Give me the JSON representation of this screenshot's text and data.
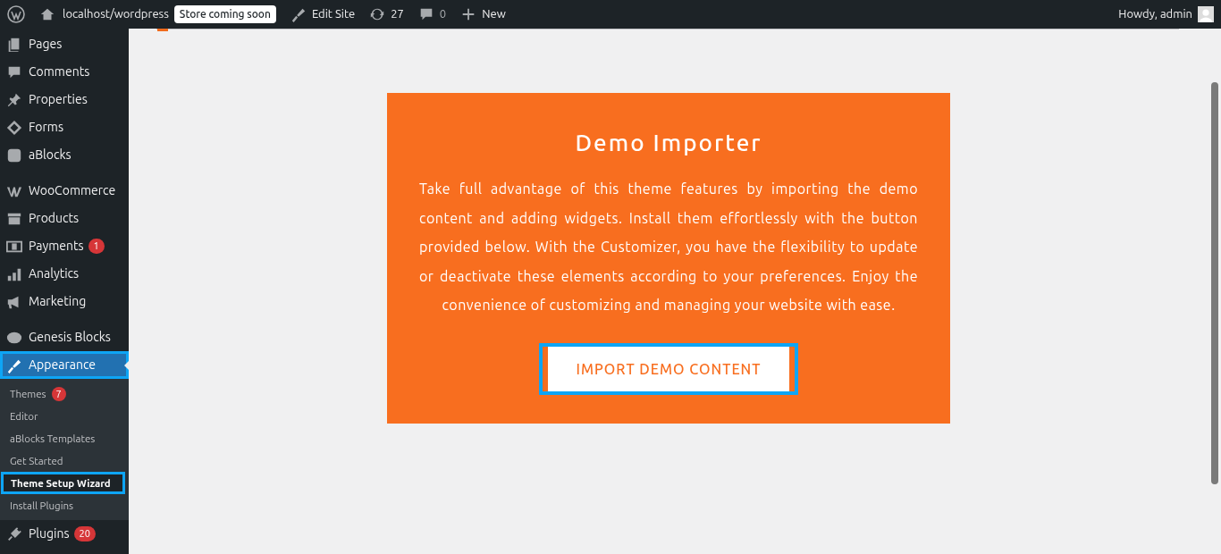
{
  "admin_bar": {
    "site": "localhost/wordpress",
    "store_badge": "Store coming soon",
    "edit_site": "Edit Site",
    "updates": "27",
    "comments": "0",
    "new": "New",
    "greeting": "Howdy, admin"
  },
  "sidebar": {
    "groups": [
      [
        {
          "label": "Pages",
          "selected": false
        },
        {
          "label": "Comments",
          "selected": false
        },
        {
          "label": "Properties",
          "selected": false
        },
        {
          "label": "Forms",
          "selected": false
        },
        {
          "label": "aBlocks",
          "selected": false
        }
      ],
      [
        {
          "label": "WooCommerce",
          "selected": false
        },
        {
          "label": "Products",
          "selected": false
        },
        {
          "label": "Payments",
          "badge": "1",
          "selected": false
        },
        {
          "label": "Analytics",
          "selected": false
        },
        {
          "label": "Marketing",
          "selected": false
        }
      ],
      [
        {
          "label": "Genesis Blocks",
          "selected": false
        },
        {
          "label": "Appearance",
          "selected": true,
          "children": [
            {
              "label": "Themes",
              "badge": "7",
              "selected": false
            },
            {
              "label": "Editor",
              "selected": false
            },
            {
              "label": "aBlocks Templates",
              "selected": false
            },
            {
              "label": "Get Started",
              "selected": false
            },
            {
              "label": "Theme Setup Wizard",
              "selected": true
            },
            {
              "label": "Install Plugins",
              "selected": false
            }
          ]
        },
        {
          "label": "Plugins",
          "badge": "20",
          "selected": false
        }
      ]
    ]
  },
  "card": {
    "title": "Demo Importer",
    "text": "Take full advantage of this theme features by importing the demo content and adding widgets. Install them effortlessly with the button provided below. With the Customizer, you have the flexibility to update or deactivate these elements according to your preferences. Enjoy the convenience of customizing and managing your website with ease.",
    "button": "IMPORT DEMO CONTENT"
  }
}
